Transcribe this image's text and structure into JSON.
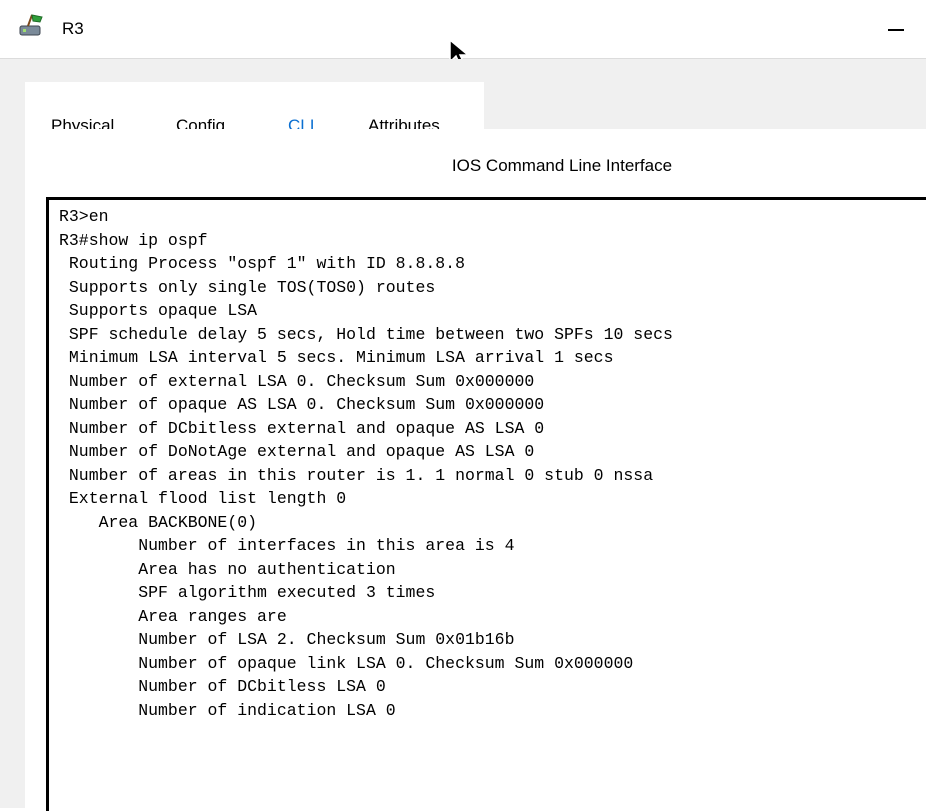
{
  "window": {
    "title": "R3",
    "icon": "router-icon",
    "minimize_glyph": "—"
  },
  "tabs": [
    {
      "label": "Physical",
      "active": false
    },
    {
      "label": "Config",
      "active": false
    },
    {
      "label": "CLI",
      "active": true
    },
    {
      "label": "Attributes",
      "active": false
    }
  ],
  "panel": {
    "title": "IOS Command Line Interface"
  },
  "console": {
    "lines": [
      "R3>en",
      "R3#show ip ospf",
      " Routing Process \"ospf 1\" with ID 8.8.8.8",
      " Supports only single TOS(TOS0) routes",
      " Supports opaque LSA",
      " SPF schedule delay 5 secs, Hold time between two SPFs 10 secs",
      " Minimum LSA interval 5 secs. Minimum LSA arrival 1 secs",
      " Number of external LSA 0. Checksum Sum 0x000000",
      " Number of opaque AS LSA 0. Checksum Sum 0x000000",
      " Number of DCbitless external and opaque AS LSA 0",
      " Number of DoNotAge external and opaque AS LSA 0",
      " Number of areas in this router is 1. 1 normal 0 stub 0 nssa",
      " External flood list length 0",
      "    Area BACKBONE(0)",
      "        Number of interfaces in this area is 4",
      "        Area has no authentication",
      "        SPF algorithm executed 3 times",
      "        Area ranges are",
      "        Number of LSA 2. Checksum Sum 0x01b16b",
      "        Number of opaque link LSA 0. Checksum Sum 0x000000",
      "        Number of DCbitless LSA 0",
      "        Number of indication LSA 0"
    ]
  },
  "colors": {
    "active_tab_text": "#0a6fd1",
    "active_tab_underline": "#1c8be6",
    "client_bg": "#f0f0f0"
  }
}
